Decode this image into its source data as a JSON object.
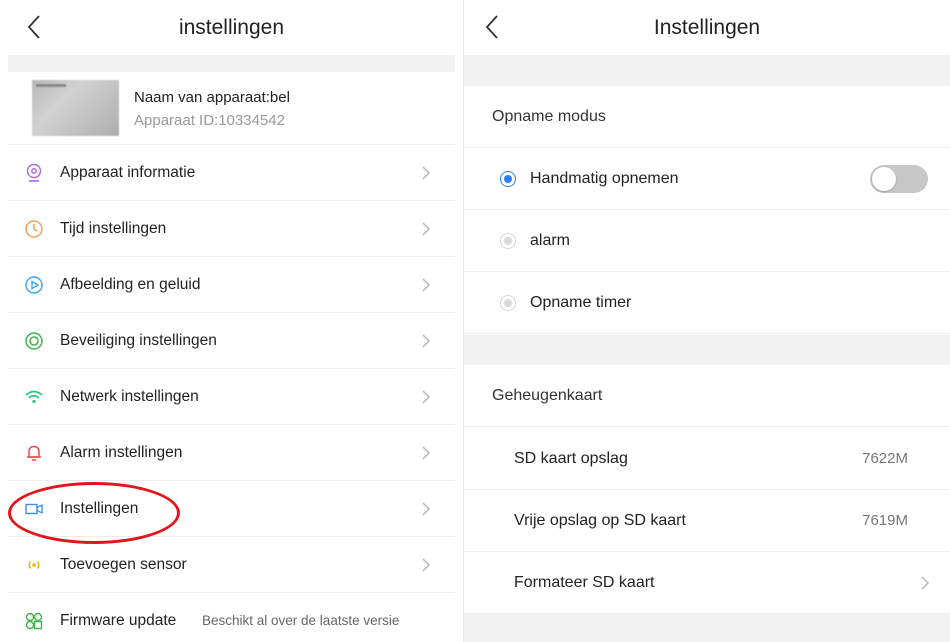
{
  "left": {
    "title": "instellingen",
    "device": {
      "name": "Naam van apparaat:bel",
      "id": "Apparaat ID:10334542"
    },
    "items": [
      {
        "label": "Apparaat informatie",
        "icon": "camera-icon",
        "color": "#b06bd6"
      },
      {
        "label": "Tijd instellingen",
        "icon": "clock-icon",
        "color": "#f0a060"
      },
      {
        "label": "Afbeelding en geluid",
        "icon": "play-icon",
        "color": "#3aa8e8"
      },
      {
        "label": "Beveiliging instellingen",
        "icon": "lifebuoy-icon",
        "color": "#3cb54a"
      },
      {
        "label": "Netwerk instellingen",
        "icon": "wifi-icon",
        "color": "#2fc27a"
      },
      {
        "label": "Alarm instellingen",
        "icon": "bell-icon",
        "color": "#f04b4b"
      },
      {
        "label": "Instellingen",
        "icon": "video-camera-icon",
        "color": "#3d8ff0"
      },
      {
        "label": "Toevoegen sensor",
        "icon": "sensor-icon",
        "color": "#f2b400"
      },
      {
        "label": "Firmware update",
        "sub": "Beschikt al over de laatste versie",
        "icon": "firmware-icon",
        "color": "#3cb54a"
      }
    ],
    "highlight_color": "#e3141b"
  },
  "right": {
    "title": "Instellingen",
    "record_mode": {
      "heading": "Opname modus",
      "options": [
        {
          "label": "Handmatig opnemen",
          "selected": true,
          "toggle_on": false
        },
        {
          "label": "alarm",
          "selected": false
        },
        {
          "label": "Opname timer",
          "selected": false
        }
      ]
    },
    "memory_card": {
      "heading": "Geheugenkaart",
      "rows": [
        {
          "label": "SD kaart opslag",
          "value": "7622M"
        },
        {
          "label": "Vrije opslag op SD kaart",
          "value": "7619M"
        },
        {
          "label": "Formateer SD kaart",
          "value": ""
        }
      ]
    },
    "accent_color": "#2f7df2"
  }
}
